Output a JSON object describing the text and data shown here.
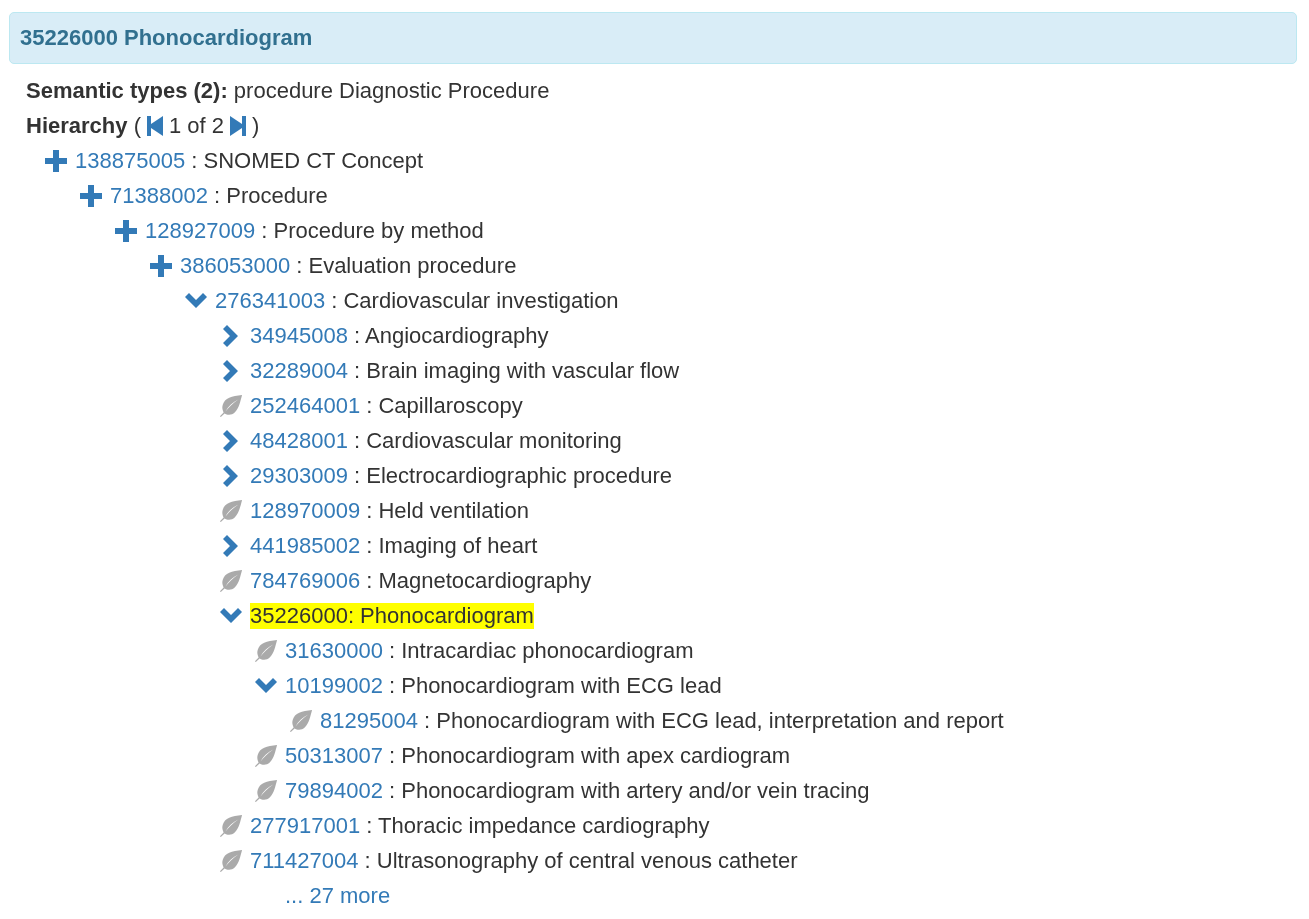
{
  "header": {
    "title": "35226000 Phonocardiogram"
  },
  "semantic_types": {
    "label": "Semantic types (2):",
    "value": "procedure Diagnostic Procedure"
  },
  "hierarchy": {
    "label": "Hierarchy",
    "open": "(",
    "pager": "1 of 2",
    "close": ")"
  },
  "tree": [
    {
      "kind": "plus",
      "code": "138875005",
      "text": ": SNOMED CT Concept",
      "selected": false,
      "children": [
        {
          "kind": "plus",
          "code": "71388002",
          "text": ": Procedure",
          "selected": false,
          "children": [
            {
              "kind": "plus",
              "code": "128927009",
              "text": ": Procedure by method",
              "selected": false,
              "children": [
                {
                  "kind": "plus",
                  "code": "386053000",
                  "text": ": Evaluation procedure",
                  "selected": false,
                  "children": [
                    {
                      "kind": "expanded",
                      "code": "276341003",
                      "text": ": Cardiovascular investigation",
                      "selected": false,
                      "more": "... 27 more",
                      "children": [
                        {
                          "kind": "collapsed",
                          "code": "34945008",
                          "text": ": Angiocardiography",
                          "selected": false
                        },
                        {
                          "kind": "collapsed",
                          "code": "32289004",
                          "text": ": Brain imaging with vascular flow",
                          "selected": false
                        },
                        {
                          "kind": "leaf",
                          "code": "252464001",
                          "text": ": Capillaroscopy",
                          "selected": false
                        },
                        {
                          "kind": "collapsed",
                          "code": "48428001",
                          "text": ": Cardiovascular monitoring",
                          "selected": false
                        },
                        {
                          "kind": "collapsed",
                          "code": "29303009",
                          "text": ": Electrocardiographic procedure",
                          "selected": false
                        },
                        {
                          "kind": "leaf",
                          "code": "128970009",
                          "text": ": Held ventilation",
                          "selected": false
                        },
                        {
                          "kind": "collapsed",
                          "code": "441985002",
                          "text": ": Imaging of heart",
                          "selected": false
                        },
                        {
                          "kind": "leaf",
                          "code": "784769006",
                          "text": ": Magnetocardiography",
                          "selected": false
                        },
                        {
                          "kind": "expanded",
                          "text": "35226000: Phonocardiogram",
                          "selected": true,
                          "children": [
                            {
                              "kind": "leaf",
                              "code": "31630000",
                              "text": ": Intracardiac phonocardiogram",
                              "selected": false
                            },
                            {
                              "kind": "expanded",
                              "code": "10199002",
                              "text": ": Phonocardiogram with ECG lead",
                              "selected": false,
                              "children": [
                                {
                                  "kind": "leaf",
                                  "code": "81295004",
                                  "text": ": Phonocardiogram with ECG lead, interpretation and report",
                                  "selected": false
                                }
                              ]
                            },
                            {
                              "kind": "leaf",
                              "code": "50313007",
                              "text": ": Phonocardiogram with apex cardiogram",
                              "selected": false
                            },
                            {
                              "kind": "leaf",
                              "code": "79894002",
                              "text": ": Phonocardiogram with artery and/or vein tracing",
                              "selected": false
                            }
                          ]
                        },
                        {
                          "kind": "leaf",
                          "code": "277917001",
                          "text": ": Thoracic impedance cardiography",
                          "selected": false
                        },
                        {
                          "kind": "leaf",
                          "code": "711427004",
                          "text": ": Ultrasonography of central venous catheter",
                          "selected": false
                        }
                      ]
                    }
                  ]
                }
              ]
            }
          ]
        }
      ]
    }
  ]
}
